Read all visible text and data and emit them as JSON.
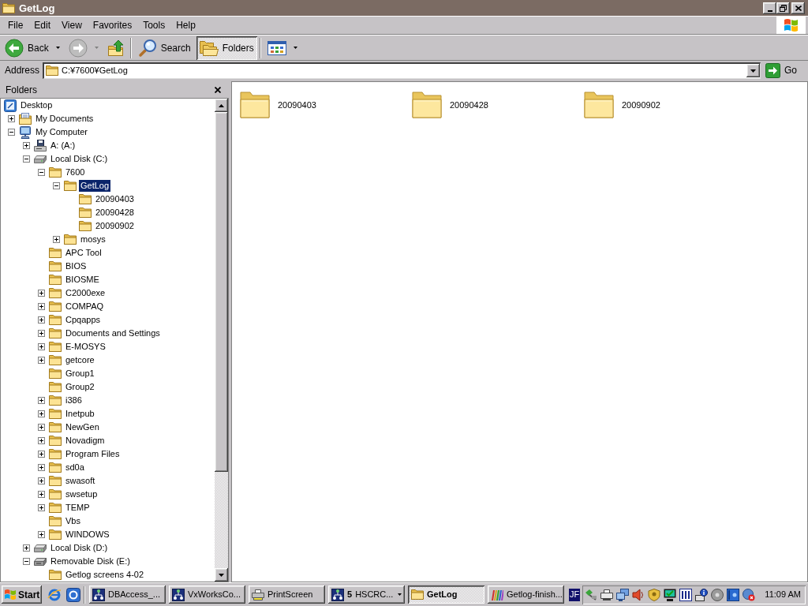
{
  "window": {
    "title": "GetLog"
  },
  "menu": [
    "File",
    "Edit",
    "View",
    "Favorites",
    "Tools",
    "Help"
  ],
  "toolbar": {
    "groups": [
      [
        {
          "kind": "back",
          "label": "Back",
          "disabled": false,
          "pressed": false
        },
        {
          "kind": "forward",
          "disabled": true,
          "pressed": false
        },
        {
          "kind": "up",
          "disabled": false,
          "pressed": false
        }
      ],
      [
        {
          "kind": "search",
          "label": "Search",
          "disabled": false,
          "pressed": false
        },
        {
          "kind": "folders",
          "label": "Folders",
          "disabled": false,
          "pressed": true
        }
      ],
      [
        {
          "kind": "views",
          "disabled": false,
          "pressed": false
        }
      ]
    ]
  },
  "address_bar": {
    "label": "Address",
    "value": "C:¥7600¥GetLog",
    "go": "Go"
  },
  "folders_pane": {
    "title": "Folders",
    "tree": [
      {
        "label": "Desktop",
        "kind": "desktop",
        "selected": false,
        "children": [
          {
            "label": "My Documents",
            "kind": "documents",
            "expanded": false,
            "selected": false
          },
          {
            "label": "My Computer",
            "kind": "computer",
            "expanded": true,
            "selected": false,
            "children": [
              {
                "label": "A: (A:)",
                "kind": "floppy",
                "expanded": false,
                "selected": false
              },
              {
                "label": "Local Disk (C:)",
                "kind": "disk",
                "expanded": true,
                "selected": false,
                "children": [
                  {
                    "label": "7600",
                    "kind": "folder",
                    "expanded": true,
                    "selected": false,
                    "children": [
                      {
                        "label": "GetLog",
                        "kind": "folder",
                        "expanded": true,
                        "selected": true,
                        "children": [
                          {
                            "label": "20090403",
                            "kind": "folder",
                            "selected": false
                          },
                          {
                            "label": "20090428",
                            "kind": "folder",
                            "selected": false
                          },
                          {
                            "label": "20090902",
                            "kind": "folder",
                            "selected": false
                          }
                        ]
                      },
                      {
                        "label": "mosys",
                        "kind": "folder",
                        "expanded": false,
                        "selected": false
                      }
                    ]
                  },
                  {
                    "label": "APC Tool",
                    "kind": "folder",
                    "selected": false
                  },
                  {
                    "label": "BIOS",
                    "kind": "folder",
                    "selected": false
                  },
                  {
                    "label": "BIOSME",
                    "kind": "folder",
                    "selected": false
                  },
                  {
                    "label": "C2000exe",
                    "kind": "folder",
                    "expanded": false,
                    "selected": false
                  },
                  {
                    "label": "COMPAQ",
                    "kind": "folder",
                    "expanded": false,
                    "selected": false
                  },
                  {
                    "label": "Cpqapps",
                    "kind": "folder",
                    "expanded": false,
                    "selected": false
                  },
                  {
                    "label": "Documents and Settings",
                    "kind": "folder",
                    "expanded": false,
                    "selected": false
                  },
                  {
                    "label": "E-MOSYS",
                    "kind": "folder",
                    "expanded": false,
                    "selected": false
                  },
                  {
                    "label": "getcore",
                    "kind": "folder",
                    "expanded": false,
                    "selected": false
                  },
                  {
                    "label": "Group1",
                    "kind": "folder",
                    "selected": false
                  },
                  {
                    "label": "Group2",
                    "kind": "folder",
                    "selected": false
                  },
                  {
                    "label": "i386",
                    "kind": "folder",
                    "expanded": false,
                    "selected": false
                  },
                  {
                    "label": "Inetpub",
                    "kind": "folder",
                    "expanded": false,
                    "selected": false
                  },
                  {
                    "label": "NewGen",
                    "kind": "folder",
                    "expanded": false,
                    "selected": false
                  },
                  {
                    "label": "Novadigm",
                    "kind": "folder",
                    "expanded": false,
                    "selected": false
                  },
                  {
                    "label": "Program Files",
                    "kind": "folder",
                    "expanded": false,
                    "selected": false
                  },
                  {
                    "label": "sd0a",
                    "kind": "folder",
                    "expanded": false,
                    "selected": false
                  },
                  {
                    "label": "swasoft",
                    "kind": "folder",
                    "expanded": false,
                    "selected": false
                  },
                  {
                    "label": "swsetup",
                    "kind": "folder",
                    "expanded": false,
                    "selected": false
                  },
                  {
                    "label": "TEMP",
                    "kind": "folder",
                    "expanded": false,
                    "selected": false
                  },
                  {
                    "label": "Vbs",
                    "kind": "folder",
                    "selected": false
                  },
                  {
                    "label": "WINDOWS",
                    "kind": "folder",
                    "expanded": false,
                    "selected": false
                  }
                ]
              },
              {
                "label": "Local Disk (D:)",
                "kind": "disk",
                "expanded": false,
                "selected": false
              },
              {
                "label": "Removable Disk (E:)",
                "kind": "removable",
                "expanded": true,
                "selected": false,
                "children": [
                  {
                    "label": "Getlog screens 4-02",
                    "kind": "folder",
                    "selected": false
                  }
                ]
              }
            ]
          }
        ]
      }
    ]
  },
  "content": {
    "items": [
      {
        "label": "20090403"
      },
      {
        "label": "20090428"
      },
      {
        "label": "20090902"
      }
    ]
  },
  "taskbar": {
    "start": "Start",
    "tasks": [
      {
        "kind": "app",
        "label": "DBAccess_...",
        "selected": false
      },
      {
        "kind": "app",
        "label": "VxWorksCo...",
        "selected": false
      },
      {
        "kind": "printer",
        "label": "PrintScreen",
        "selected": false
      },
      {
        "kind": "group",
        "count": "5",
        "label": "HSCRC...",
        "selected": false
      },
      {
        "kind": "folder",
        "label": "GetLog",
        "selected": true
      },
      {
        "kind": "paint",
        "label": "Getlog-finish...",
        "selected": false
      }
    ],
    "language": "JF",
    "clock": "11:09 AM"
  }
}
